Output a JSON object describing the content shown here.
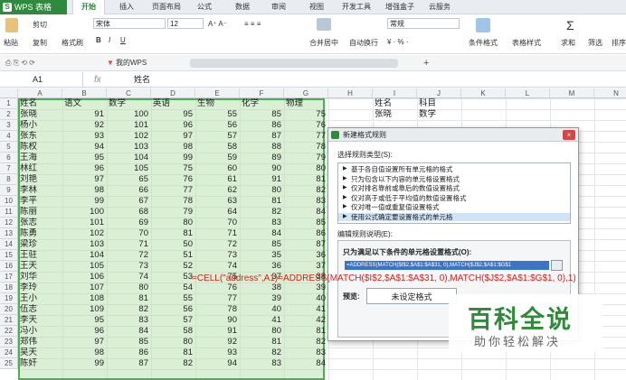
{
  "app": {
    "title": "WPS 表格",
    "accent": "#2f8a3e"
  },
  "menu_tabs": [
    {
      "label": "开始",
      "active": true
    },
    {
      "label": "插入"
    },
    {
      "label": "页面布局"
    },
    {
      "label": "公式"
    },
    {
      "label": "数据"
    },
    {
      "label": "审阅"
    },
    {
      "label": "视图"
    },
    {
      "label": "开发工具"
    },
    {
      "label": "增强盒子"
    },
    {
      "label": "云服务"
    }
  ],
  "ribbon": {
    "cut": "剪切",
    "paste": "粘贴",
    "copy": "复制",
    "format_painter": "格式刷",
    "font": "宋体",
    "size": "12",
    "merge": "合并居中",
    "wrap": "自动换行",
    "number_format": "常规",
    "cond_format": "条件格式",
    "table_style": "表格样式",
    "sum": "求和",
    "filter": "筛选",
    "sort": "排序"
  },
  "doc_tab": "我的WPS",
  "formula_bar": {
    "cell": "A1",
    "fx": "fx",
    "value": "姓名"
  },
  "columns": [
    "A",
    "B",
    "C",
    "D",
    "E",
    "F",
    "G",
    "H",
    "I",
    "J",
    "K",
    "L",
    "M",
    "N"
  ],
  "rows": [
    [
      "姓名",
      "语文",
      "数学",
      "英语",
      "生物",
      "化学",
      "物理"
    ],
    [
      "张晓",
      "91",
      "100",
      "95",
      "55",
      "85",
      "75"
    ],
    [
      "杨小",
      "92",
      "101",
      "96",
      "56",
      "86",
      "76"
    ],
    [
      "张东",
      "93",
      "102",
      "97",
      "57",
      "87",
      "77"
    ],
    [
      "陈权",
      "94",
      "103",
      "98",
      "58",
      "88",
      "78"
    ],
    [
      "王海",
      "95",
      "104",
      "99",
      "59",
      "89",
      "79"
    ],
    [
      "林红",
      "96",
      "105",
      "75",
      "60",
      "90",
      "80"
    ],
    [
      "刘艳",
      "97",
      "65",
      "76",
      "61",
      "91",
      "81"
    ],
    [
      "李林",
      "98",
      "66",
      "77",
      "62",
      "80",
      "82"
    ],
    [
      "李平",
      "99",
      "67",
      "78",
      "63",
      "81",
      "83"
    ],
    [
      "陈丽",
      "100",
      "68",
      "79",
      "64",
      "82",
      "84"
    ],
    [
      "张志",
      "101",
      "69",
      "80",
      "70",
      "83",
      "85"
    ],
    [
      "陈勇",
      "102",
      "70",
      "81",
      "71",
      "84",
      "86"
    ],
    [
      "梁珍",
      "103",
      "71",
      "50",
      "72",
      "85",
      "87"
    ],
    [
      "王驻",
      "104",
      "72",
      "51",
      "73",
      "35",
      "36"
    ],
    [
      "王天",
      "105",
      "73",
      "52",
      "74",
      "36",
      "37"
    ],
    [
      "刘华",
      "106",
      "74",
      "53",
      "75",
      "37",
      "38"
    ],
    [
      "李玲",
      "107",
      "80",
      "54",
      "76",
      "38",
      "39"
    ],
    [
      "王小",
      "108",
      "81",
      "55",
      "77",
      "39",
      "40"
    ],
    [
      "伍志",
      "109",
      "82",
      "56",
      "78",
      "40",
      "41"
    ],
    [
      "李天",
      "95",
      "83",
      "57",
      "90",
      "41",
      "42"
    ],
    [
      "冯小",
      "96",
      "84",
      "58",
      "91",
      "80",
      "81"
    ],
    [
      "郑伟",
      "97",
      "85",
      "80",
      "92",
      "81",
      "82"
    ],
    [
      "吴天",
      "98",
      "86",
      "81",
      "93",
      "82",
      "83"
    ],
    [
      "陈奸",
      "99",
      "87",
      "82",
      "94",
      "83",
      "84"
    ]
  ],
  "side_table": [
    [
      "姓名",
      "科目"
    ],
    [
      "张晓",
      "数学"
    ]
  ],
  "dialog": {
    "title": "新建格式规则",
    "close": "×",
    "type_label": "选择规则类型(S):",
    "rules": [
      "基于各自值设置所有单元格的格式",
      "只为包含以下内容的单元格设置格式",
      "仅对排名靠前或靠后的数值设置格式",
      "仅对高于或低于平均值的数值设置格式",
      "仅对唯一值或重复值设置格式",
      "使用公式确定要设置格式的单元格"
    ],
    "selected_rule": 5,
    "desc_label": "编辑规则说明(E):",
    "condition_label": "只为满足以下条件的单元格设置格式(O):",
    "formula": "=ADDRESS(MATCH($I$2,$A$1:$A$31, 0),MATCH($J$2,$A$1:$G$1",
    "preview_label": "预览:",
    "preview_value": "未设定格式"
  },
  "overlay_formula": "=CELL(\"address\",A1)=ADDRESS(MATCH($I$2,$A$1:$A$31, 0),MATCH($J$2,$A$1:$G$1, 0),1)",
  "watermark": {
    "big": "百科全说",
    "small": "助你轻松解决"
  }
}
